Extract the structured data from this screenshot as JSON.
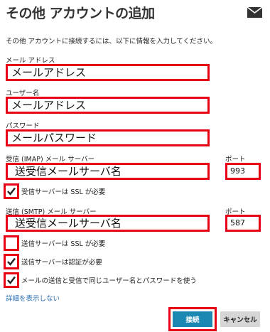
{
  "header": {
    "title": "その他 アカウントの追加",
    "mail_icon": "envelope-icon"
  },
  "intro": "その他 アカウントに接続するには、以下に情報を入力してください。",
  "fields": {
    "email": {
      "label": "メール アドレス",
      "value": "メールアドレス"
    },
    "username": {
      "label": "ユーザー名",
      "value": "メールアドレス"
    },
    "password": {
      "label": "パスワード",
      "value": "メールパスワード"
    },
    "incoming_server": {
      "label": "受信 (IMAP) メール サーバー",
      "value": "送受信メールサーバ名"
    },
    "incoming_port": {
      "label": "ポート",
      "value": "993"
    },
    "outgoing_server": {
      "label": "送信 (SMTP) メール サーバー",
      "value": "送受信メールサーバ名"
    },
    "outgoing_port": {
      "label": "ポート",
      "value": "587"
    }
  },
  "checkboxes": {
    "incoming_ssl": {
      "label": "受信サーバーは SSL が必要",
      "checked": true
    },
    "outgoing_ssl": {
      "label": "送信サーバーは SSL が必要",
      "checked": false
    },
    "outgoing_auth": {
      "label": "送信サーバーは認証が必要",
      "checked": true
    },
    "same_credentials": {
      "label": "メールの送信と受信で同じユーザー名とパスワードを使う",
      "checked": true
    }
  },
  "details_link": "詳細を表示しない",
  "buttons": {
    "connect": "接続",
    "cancel": "キャンセル"
  },
  "colors": {
    "highlight_red": "#e60012",
    "connect_blue": "#1a88b3",
    "link_blue": "#2a6fb5"
  }
}
